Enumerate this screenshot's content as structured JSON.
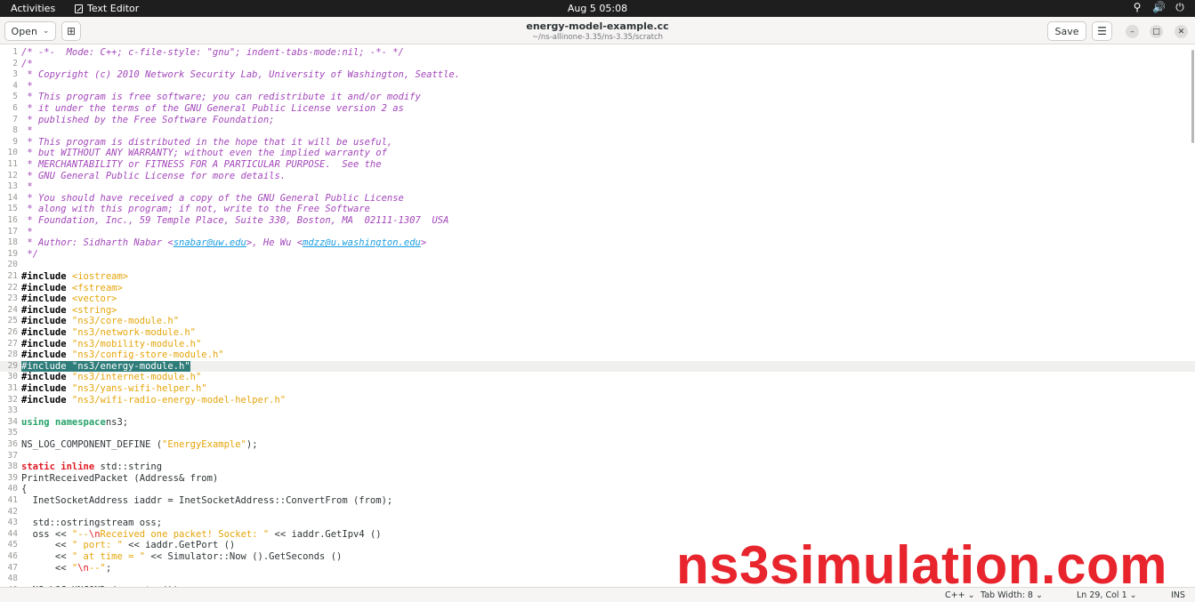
{
  "topbar": {
    "activities": "Activities",
    "app_name": "Text Editor",
    "clock": "Aug 5  05:08"
  },
  "header": {
    "open_label": "Open",
    "title": "energy-model-example.cc",
    "subtitle": "~/ns-allinone-3.35/ns-3.35/scratch",
    "save_label": "Save"
  },
  "editor": {
    "current_line": 29,
    "lines": [
      [
        [
          "cm",
          "/* -*-  Mode: C++; c-file-style: \"gnu\"; indent-tabs-mode:nil; -*- */"
        ]
      ],
      [
        [
          "cm",
          "/*"
        ]
      ],
      [
        [
          "cm",
          " * Copyright (c) 2010 Network Security Lab, University of Washington, Seattle."
        ]
      ],
      [
        [
          "cm",
          " *"
        ]
      ],
      [
        [
          "cm",
          " * This program is free software; you can redistribute it and/or modify"
        ]
      ],
      [
        [
          "cm",
          " * it under the terms of the GNU General Public License version 2 as"
        ]
      ],
      [
        [
          "cm",
          " * published by the Free Software Foundation;"
        ]
      ],
      [
        [
          "cm",
          " *"
        ]
      ],
      [
        [
          "cm",
          " * This program is distributed in the hope that it will be useful,"
        ]
      ],
      [
        [
          "cm",
          " * but WITHOUT ANY WARRANTY; without even the implied warranty of"
        ]
      ],
      [
        [
          "cm",
          " * MERCHANTABILITY or FITNESS FOR A PARTICULAR PURPOSE.  See the"
        ]
      ],
      [
        [
          "cm",
          " * GNU General Public License for more details."
        ]
      ],
      [
        [
          "cm",
          " *"
        ]
      ],
      [
        [
          "cm",
          " * You should have received a copy of the GNU General Public License"
        ]
      ],
      [
        [
          "cm",
          " * along with this program; if not, write to the Free Software"
        ]
      ],
      [
        [
          "cm",
          " * Foundation, Inc., 59 Temple Place, Suite 330, Boston, MA  02111-1307  USA"
        ]
      ],
      [
        [
          "cm",
          " *"
        ]
      ],
      [
        [
          "cm",
          " * Author: Sidharth Nabar <"
        ],
        [
          "link",
          "snabar@uw.edu"
        ],
        [
          "cm",
          ">, He Wu <"
        ],
        [
          "link",
          "mdzz@u.washington.edu"
        ],
        [
          "cm",
          ">"
        ]
      ],
      [
        [
          "cm",
          " */"
        ]
      ],
      [],
      [
        [
          "pre",
          "#include "
        ],
        [
          "inc",
          "<iostream>"
        ]
      ],
      [
        [
          "pre",
          "#include "
        ],
        [
          "inc",
          "<fstream>"
        ]
      ],
      [
        [
          "pre",
          "#include "
        ],
        [
          "inc",
          "<vector>"
        ]
      ],
      [
        [
          "pre",
          "#include "
        ],
        [
          "inc",
          "<string>"
        ]
      ],
      [
        [
          "pre",
          "#include "
        ],
        [
          "inc",
          "\"ns3/core-module.h\""
        ]
      ],
      [
        [
          "pre",
          "#include "
        ],
        [
          "inc",
          "\"ns3/network-module.h\""
        ]
      ],
      [
        [
          "pre",
          "#include "
        ],
        [
          "inc",
          "\"ns3/mobility-module.h\""
        ]
      ],
      [
        [
          "pre",
          "#include "
        ],
        [
          "inc",
          "\"ns3/config-store-module.h\""
        ]
      ],
      [
        [
          "sel",
          "#include \"ns3/energy-module.h\""
        ]
      ],
      [
        [
          "pre",
          "#include "
        ],
        [
          "inc",
          "\"ns3/internet-module.h\""
        ]
      ],
      [
        [
          "pre",
          "#include "
        ],
        [
          "inc",
          "\"ns3/yans-wifi-helper.h\""
        ]
      ],
      [
        [
          "pre",
          "#include "
        ],
        [
          "inc",
          "\"ns3/wifi-radio-energy-model-helper.h\""
        ]
      ],
      [],
      [
        [
          "kw",
          "using namespace"
        ],
        [
          "",
          "ns3;"
        ]
      ],
      [],
      [
        [
          "",
          "NS_LOG_COMPONENT_DEFINE ("
        ],
        [
          "str",
          "\"EnergyExample\""
        ],
        [
          "",
          ");"
        ]
      ],
      [],
      [
        [
          "typ",
          "static inline"
        ],
        [
          "",
          " std::string"
        ]
      ],
      [
        [
          "",
          "PrintReceivedPacket (Address& from)"
        ]
      ],
      [
        [
          "",
          "{"
        ]
      ],
      [
        [
          "",
          "  InetSocketAddress iaddr = InetSocketAddress::ConvertFrom (from);"
        ]
      ],
      [],
      [
        [
          "",
          "  std::ostringstream oss;"
        ]
      ],
      [
        [
          "",
          "  oss << "
        ],
        [
          "str",
          "\"--"
        ],
        [
          "esc",
          "\\n"
        ],
        [
          "str",
          "Received one packet! Socket: \""
        ],
        [
          "",
          " << iaddr.GetIpv4 ()"
        ]
      ],
      [
        [
          "",
          "      << "
        ],
        [
          "str",
          "\" port: \""
        ],
        [
          "",
          " << iaddr.GetPort ()"
        ]
      ],
      [
        [
          "",
          "      << "
        ],
        [
          "str",
          "\" at time = \""
        ],
        [
          "",
          " << Simulator::Now ().GetSeconds ()"
        ]
      ],
      [
        [
          "",
          "      << "
        ],
        [
          "str",
          "\""
        ],
        [
          "esc",
          "\\n"
        ],
        [
          "str",
          "--\""
        ],
        [
          "",
          ";"
        ]
      ],
      [],
      [
        [
          "",
          "  NS_LOG_UNCOND (oss.str ());"
        ]
      ]
    ]
  },
  "watermark": "ns3simulation.com",
  "statusbar": {
    "language": "C++",
    "tab_width": "Tab Width: 8",
    "position": "Ln 29, Col 1",
    "mode": "INS"
  },
  "colors": {
    "comment": "#a347ba",
    "string": "#e5a50a",
    "keyword": "#26a269",
    "selection": "#2f7d7a",
    "watermark": "#e8242d"
  }
}
